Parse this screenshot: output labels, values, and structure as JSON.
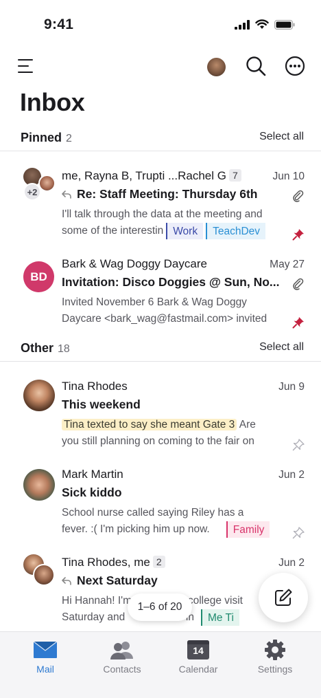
{
  "status_bar": {
    "time": "9:41"
  },
  "page": {
    "title": "Inbox"
  },
  "sections": {
    "pinned": {
      "title": "Pinned",
      "count": "2",
      "select_all": "Select all"
    },
    "other": {
      "title": "Other",
      "count": "18",
      "select_all": "Select all"
    }
  },
  "mails": [
    {
      "from": "me, Rayna B, Trupti ...Rachel G",
      "thread_count": "7",
      "date": "Jun 10",
      "subject": "Re: Staff Meeting: Thursday 6th",
      "preview_line1": "I'll talk through the data at the meeting and",
      "preview_line2": "some of the interestin",
      "extra_avatars": "+2",
      "tags": [
        {
          "label": "Work",
          "color": "#3a4aa8",
          "bg": "#eceefa"
        },
        {
          "label": "TeachDev",
          "color": "#2a8fd4",
          "bg": "#e6f3fb"
        }
      ]
    },
    {
      "from": "Bark & Wag Doggy Daycare",
      "date": "May 27",
      "subject": "Invitation: Disco Doggies @ Sun, No...",
      "preview_line1": "Invited November 6 Bark & Wag Doggy",
      "preview_line2": "Daycare <bark_wag@fastmail.com> invited",
      "initials": "BD"
    },
    {
      "from": "Tina Rhodes",
      "date": "Jun 9",
      "subject": "This weekend",
      "highlight": "Tina texted to say she meant Gate 3",
      "preview_line1_rest": " Are",
      "preview_line2": "you still planning on coming to the fair on"
    },
    {
      "from": "Mark Martin",
      "date": "Jun 2",
      "subject": "Sick kiddo",
      "preview_line1": "School nurse called saying Riley has a",
      "preview_line2": "fever. :( I'm picking him up now.",
      "tags": [
        {
          "label": "Family",
          "color": "#d8336a",
          "bg": "#fde8ee"
        }
      ]
    },
    {
      "from": "Tina Rhodes, me",
      "thread_count": "2",
      "date": "Jun 2",
      "subject": "Next Saturday",
      "preview_line1": "Hi Hannah! I'm                a college visit",
      "preview_line2": "Saturday and              ack in",
      "tags": [
        {
          "label": "Me Ti",
          "color": "#1f8a6e",
          "bg": "#e3f4ee"
        }
      ]
    }
  ],
  "pager": {
    "label": "1–6 of 20"
  },
  "tabs": [
    {
      "label": "Mail",
      "icon": "mail-icon"
    },
    {
      "label": "Contacts",
      "icon": "contacts-icon"
    },
    {
      "label": "Calendar",
      "icon": "calendar-icon",
      "calendar_day": "14"
    },
    {
      "label": "Settings",
      "icon": "gear-icon"
    }
  ],
  "colors": {
    "accent": "#2e7ad1",
    "pin_active": "#c4213f",
    "pin_inactive": "#b0b0b8"
  }
}
